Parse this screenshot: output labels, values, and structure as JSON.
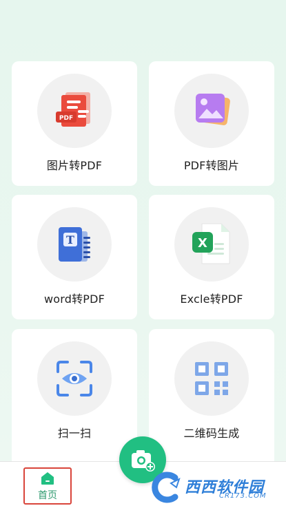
{
  "tools": [
    {
      "label": "图片转PDF",
      "icon": "pdf-document-icon"
    },
    {
      "label": "PDF转图片",
      "icon": "image-gallery-icon"
    },
    {
      "label": "word转PDF",
      "icon": "word-document-icon"
    },
    {
      "label": "Excle转PDF",
      "icon": "excel-document-icon"
    },
    {
      "label": "扫一扫",
      "icon": "scan-eye-icon"
    },
    {
      "label": "二维码生成",
      "icon": "qr-code-icon"
    }
  ],
  "tabbar": {
    "home_label": "首页"
  },
  "fab": {
    "icon": "camera-add-icon"
  },
  "watermark": {
    "brand": "西西软件园",
    "site": "CR173.COM"
  },
  "colors": {
    "accent": "#21bf82",
    "home_label": "#2f9a6f",
    "highlight_border": "#d9443a"
  }
}
